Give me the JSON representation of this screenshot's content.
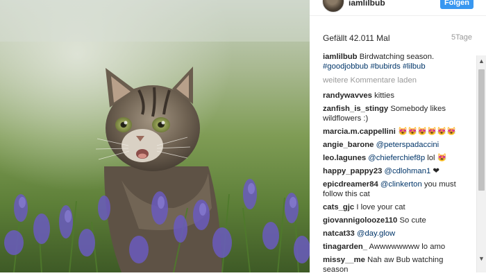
{
  "post": {
    "username": "iamlilbub",
    "follow_label": "Folgen",
    "likes": "Gefällt 42.011 Mal",
    "age": "5Tage",
    "caption_user": "iamlilbub",
    "caption_text": "Birdwatching season.",
    "caption_tags": "#goodjobbub #bubirds #lilbub",
    "load_more": "weitere Kommentare laden"
  },
  "comments": [
    {
      "user": "randywavves",
      "text": "kitties"
    },
    {
      "user": "zanfish_is_stingy",
      "text": "Somebody likes wildflowers :)"
    },
    {
      "user": "marcia.m.cappellini",
      "text": "😻😻😻😻😻😻"
    },
    {
      "user": "angie_barone",
      "mention": "@peterspadaccini",
      "text": ""
    },
    {
      "user": "leo.lagunes",
      "mention": "@chieferchief8p",
      "text": "lol 😻"
    },
    {
      "user": "happy_pappy23",
      "mention": "@cdlohman1",
      "text": "❤"
    },
    {
      "user": "epicdreamer84",
      "mention": "@clinkerton",
      "text": "you must follow this cat"
    },
    {
      "user": "cats_gjc",
      "text": "I love your cat"
    },
    {
      "user": "giovannigolooze110",
      "text": "So cute"
    },
    {
      "user": "natcat33",
      "mention": "@day.glow",
      "text": ""
    },
    {
      "user": "tinagarden_",
      "text": "Awwwwwwww lo amo"
    },
    {
      "user": "missy__me",
      "text": "Nah aw Bub watching season"
    }
  ],
  "icons": {
    "scroll_up": "scroll-up-arrow-icon",
    "scroll_down": "scroll-down-arrow-icon"
  },
  "colors": {
    "follow_button": "#3897f0",
    "hashtag": "#003569"
  }
}
